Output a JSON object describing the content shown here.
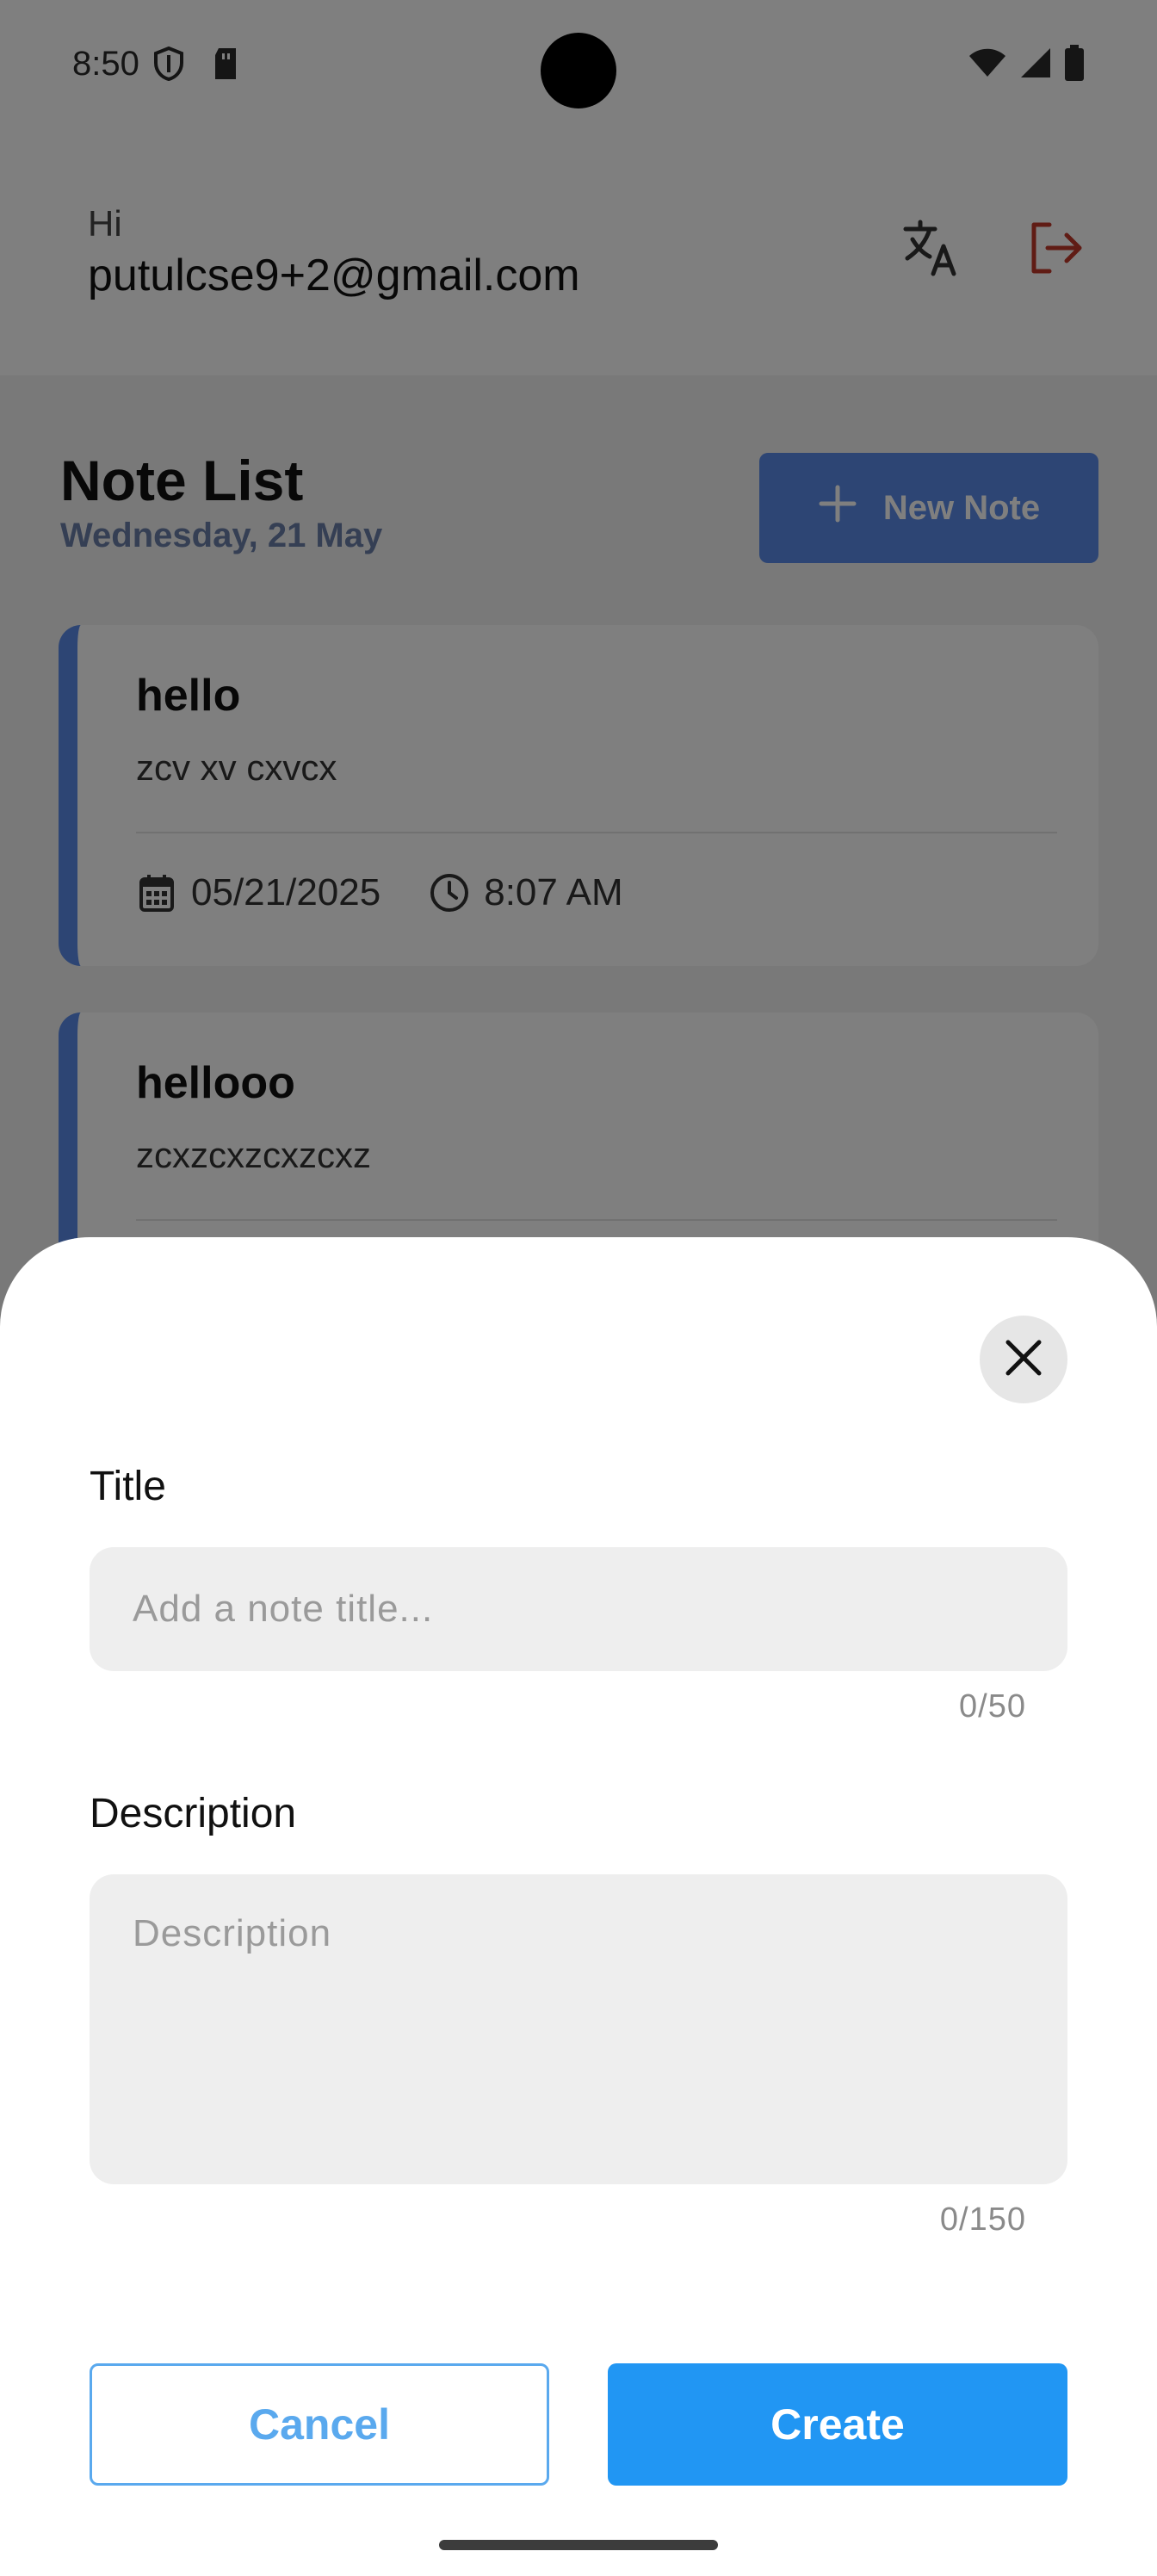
{
  "status_bar": {
    "time": "8:50",
    "left_icons": [
      "shield-icon",
      "sd-card-icon"
    ],
    "right_icons": [
      "wifi-icon",
      "signal-icon",
      "battery-icon"
    ]
  },
  "header": {
    "greeting": "Hi",
    "email": "putulcse9+2@gmail.com",
    "translate_icon": "translate-icon",
    "logout_icon": "logout-icon",
    "logout_color": "#c0392b"
  },
  "notes_page": {
    "title": "Note List",
    "date": "Wednesday, 21 May",
    "new_note_label": "New Note",
    "accent_color": "#5b8ae8",
    "notes": [
      {
        "title": "hello",
        "description": "zcv xv cxvcx",
        "date": "05/21/2025",
        "time": "8:07 AM"
      },
      {
        "title": "hellooo",
        "description": "zcxzcxzcxzcxz"
      }
    ]
  },
  "sheet": {
    "title_label": "Title",
    "title_placeholder": "Add a note title...",
    "title_value": "",
    "title_counter": "0/50",
    "description_label": "Description",
    "description_placeholder": "Description",
    "description_value": "",
    "description_counter": "0/150",
    "cancel_label": "Cancel",
    "create_label": "Create",
    "primary_color": "#2196f3"
  }
}
